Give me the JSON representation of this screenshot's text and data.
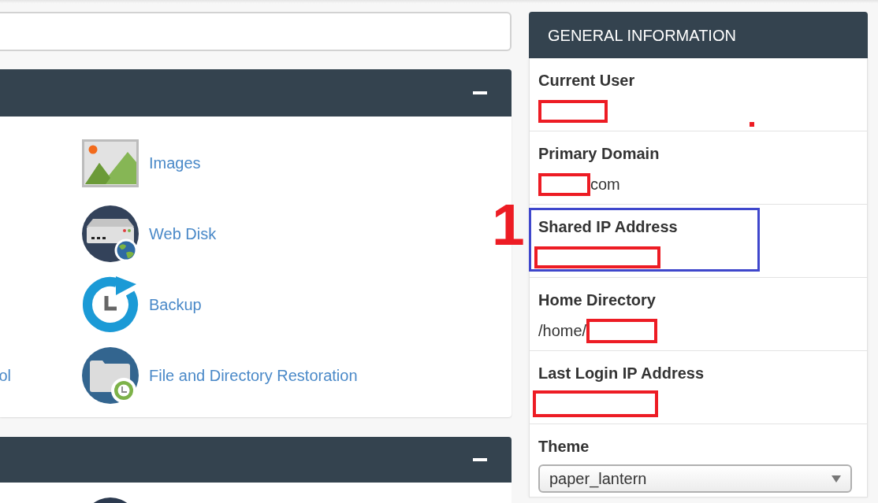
{
  "panels": [
    {
      "expanded": true,
      "rows": [
        {
          "item": {
            "kind": "images",
            "label": "Images"
          }
        },
        {
          "item": {
            "kind": "web_disk",
            "label": "Web Disk"
          }
        },
        {
          "item": {
            "kind": "backup",
            "label": "Backup"
          }
        },
        {
          "cut_item": {
            "label": "ol"
          },
          "item": {
            "kind": "file_restoration",
            "label": "File and Directory Restoration"
          }
        }
      ]
    },
    {
      "expanded": true,
      "rows": [
        {
          "item": {
            "kind": "round"
          }
        }
      ]
    }
  ],
  "general_information": {
    "title": "GENERAL INFORMATION",
    "fields": [
      {
        "kind": "text",
        "label": "Current User",
        "value_parts": [
          {
            "kind": "redaction"
          }
        ],
        "highlighted": false
      },
      {
        "kind": "text",
        "label": "Primary Domain",
        "value_parts": [
          {
            "kind": "redaction"
          },
          {
            "kind": "text",
            "text": "com"
          }
        ],
        "highlighted": false
      },
      {
        "kind": "text",
        "label": "Shared IP Address",
        "value_parts": [
          {
            "kind": "redaction"
          }
        ],
        "highlighted": true,
        "annotation": "1"
      },
      {
        "kind": "text",
        "label": "Home Directory",
        "value_parts": [
          {
            "kind": "text",
            "text": "/home/"
          },
          {
            "kind": "redaction"
          }
        ],
        "highlighted": false
      },
      {
        "kind": "text",
        "label": "Last Login IP Address",
        "value_parts": [
          {
            "kind": "redaction"
          }
        ],
        "highlighted": false
      },
      {
        "kind": "select",
        "label": "Theme",
        "value": "paper_lantern"
      }
    ]
  }
}
